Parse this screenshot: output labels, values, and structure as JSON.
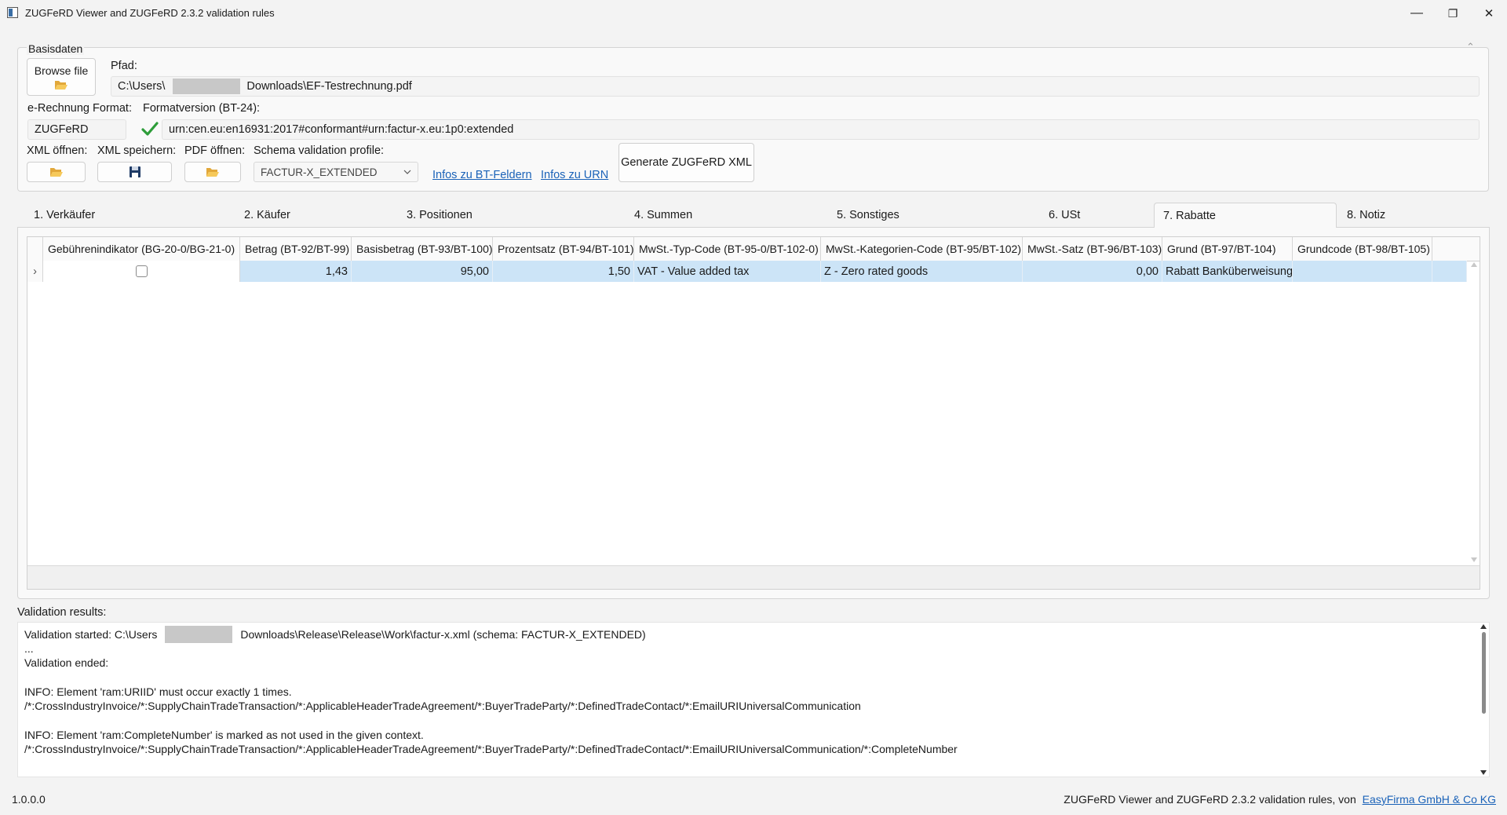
{
  "window": {
    "title": "ZUGFeRD Viewer and ZUGFeRD 2.3.2 validation rules",
    "minimize": "—",
    "restore": "❐",
    "close": "✕"
  },
  "basis": {
    "legend": "Basisdaten",
    "collapse": "⌃",
    "browse_label": "Browse file",
    "pfad_label": "Pfad:",
    "path_prefix": "C:\\Users\\",
    "path_suffix": "Downloads\\EF-Testrechnung.pdf",
    "format_label": "e-Rechnung Format:",
    "format_value": "ZUGFeRD",
    "formatversion_label": "Formatversion (BT-24):",
    "formatversion_value": "urn:cen.eu:en16931:2017#conformant#urn:factur-x.eu:1p0:extended",
    "xml_open_label": "XML öffnen:",
    "xml_save_label": "XML speichern:",
    "pdf_open_label": "PDF öffnen:",
    "schema_label": "Schema validation profile:",
    "schema_value": "FACTUR-X_EXTENDED",
    "link_bt": "Infos zu BT-Feldern",
    "link_urn": "Infos zu URN",
    "generate_label": "Generate ZUGFeRD XML"
  },
  "tabs": [
    {
      "label": "1. Verkäufer"
    },
    {
      "label": "2. Käufer"
    },
    {
      "label": "3. Positionen"
    },
    {
      "label": "4. Summen"
    },
    {
      "label": "5. Sonstiges"
    },
    {
      "label": "6. USt"
    },
    {
      "label": "7. Rabatte",
      "active": true
    },
    {
      "label": "8. Notiz"
    }
  ],
  "grid": {
    "columns": [
      "Gebührenindikator (BG-20-0/BG-21-0)",
      "Betrag (BT-92/BT-99)",
      "Basisbetrag (BT-93/BT-100)",
      "Prozentsatz (BT-94/BT-101)",
      "MwSt.-Typ-Code (BT-95-0/BT-102-0)",
      "MwSt.-Kategorien-Code (BT-95/BT-102)",
      "MwSt.-Satz (BT-96/BT-103)",
      "Grund (BT-97/BT-104)",
      "Grundcode (BT-98/BT-105)"
    ],
    "row_marker": "›",
    "rows": [
      {
        "charge_indicator": false,
        "betrag": "1,43",
        "basisbetrag": "95,00",
        "prozentsatz": "1,50",
        "typ_code": "VAT - Value added tax",
        "kategorie_code": "Z - Zero rated goods",
        "satz": "0,00",
        "grund": "Rabatt Banküberweisung",
        "grundcode": ""
      }
    ]
  },
  "validation": {
    "label": "Validation results:",
    "line1_prefix": "Validation started: C:\\Users",
    "line1_suffix": "Downloads\\Release\\Release\\Work\\factur-x.xml (schema: FACTUR-X_EXTENDED)",
    "line2": "...",
    "line3": "Validation ended:",
    "line4": "INFO: Element 'ram:URIID' must occur exactly 1 times.",
    "line5": "/*:CrossIndustryInvoice/*:SupplyChainTradeTransaction/*:ApplicableHeaderTradeAgreement/*:BuyerTradeParty/*:DefinedTradeContact/*:EmailURIUniversalCommunication",
    "line6": "INFO: Element 'ram:CompleteNumber' is marked as not used in the given context.",
    "line7": "/*:CrossIndustryInvoice/*:SupplyChainTradeTransaction/*:ApplicableHeaderTradeAgreement/*:BuyerTradeParty/*:DefinedTradeContact/*:EmailURIUniversalCommunication/*:CompleteNumber"
  },
  "status": {
    "version": "1.0.0.0",
    "credit_prefix": "ZUGFeRD Viewer and ZUGFeRD 2.3.2 validation rules, von",
    "credit_link": "EasyFirma GmbH & Co KG"
  },
  "colors": {
    "selection": "#cce4f7",
    "link": "#1a62b8",
    "check": "#2e9d3a"
  }
}
